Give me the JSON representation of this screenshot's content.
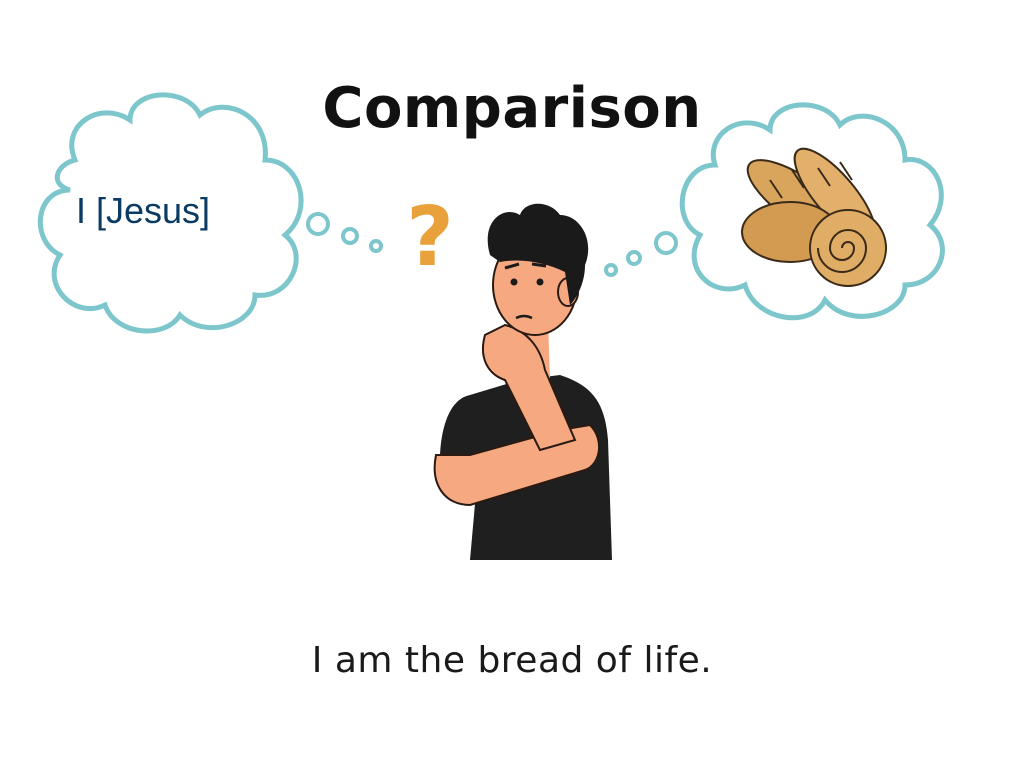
{
  "slide": {
    "title": "Comparison",
    "left_thought": "I [Jesus]",
    "caption": "I am the bread of life.",
    "question_mark": "?"
  },
  "icons": {
    "left_cloud": "thought-cloud-icon",
    "right_cloud": "thought-cloud-icon",
    "bread": "bread-loaves-icon",
    "person": "thinking-man-icon"
  },
  "colors": {
    "cloud_outline": "#7cc6cc",
    "question_mark": "#e9a23b",
    "left_thought_text": "#0b3a63",
    "skin": "#f6a980",
    "shirt": "#1f1f1f",
    "hair": "#1a1a1a",
    "bread": "#d9a55c"
  }
}
